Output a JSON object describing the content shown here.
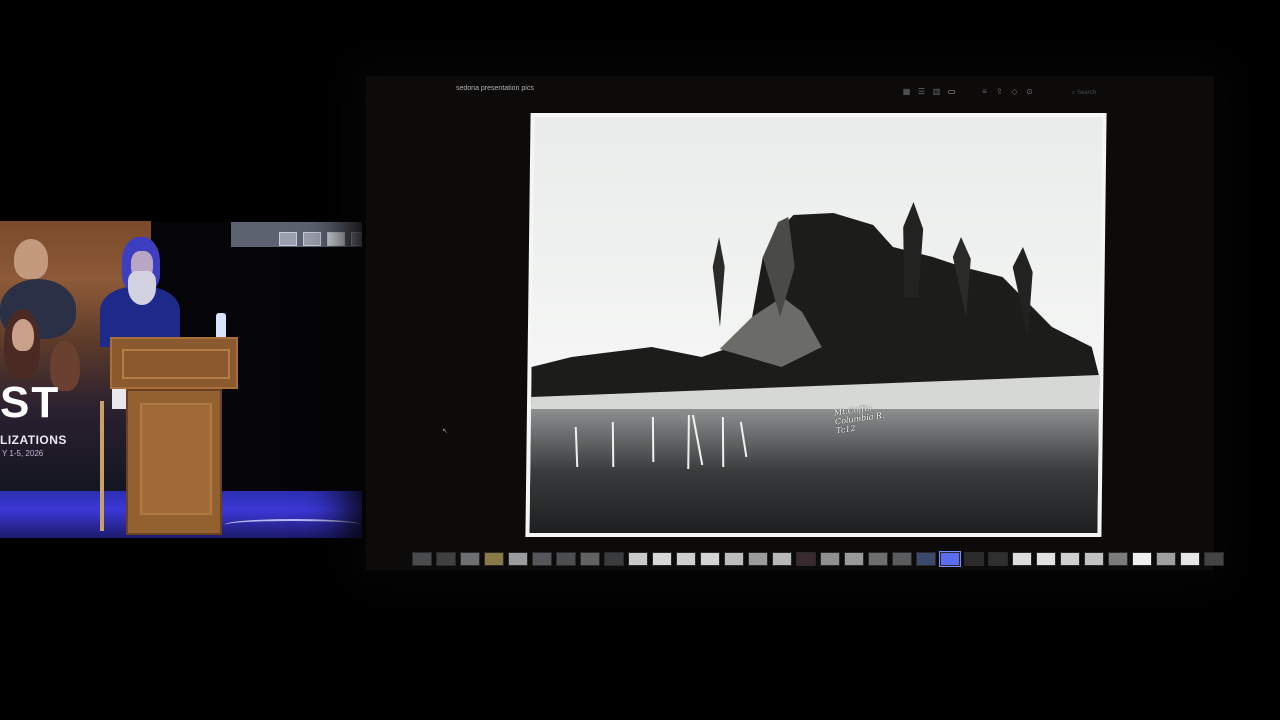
{
  "app": {
    "album_title": "sedona presentation pics",
    "search_placeholder": "Search",
    "toolbar_icons": [
      "grid-small-icon",
      "grid-medium-icon",
      "grid-large-icon",
      "single-view-icon",
      "sort-menu-icon",
      "share-icon",
      "tag-icon",
      "more-menu-icon"
    ],
    "active_view": "single-view-icon"
  },
  "photo": {
    "caption_line1": "Mt.Coffin",
    "caption_line2": "Columbia R.",
    "caption_line3": "Tc12"
  },
  "stage": {
    "banner_letters": "ST",
    "banner_subtitle": "LIZATIONS",
    "banner_date": "Y 1-5, 2026"
  },
  "filmstrip": {
    "count": 34,
    "selected_index": 22,
    "colors": [
      "#4a4b4c",
      "#3f4042",
      "#6e6f70",
      "#8a7a4a",
      "#9a9c9e",
      "#55575a",
      "#4d4e50",
      "#616264",
      "#3a3b3c",
      "#c9c9c9",
      "#d8d8d8",
      "#cfcfcf",
      "#d4d4d4",
      "#bdbdbd",
      "#9c9c9c",
      "#b8b8b8",
      "#3a2a2e",
      "#8f8f8f",
      "#9a9a9a",
      "#6d6e70",
      "#5a5b5c",
      "#3b4a6a",
      "#5b6ef0",
      "#2a2a2a",
      "#2f2f2f",
      "#dcdcdc",
      "#e2e2e2",
      "#d0d0d0",
      "#c2c2c2",
      "#7a7b7c",
      "#f0f0f0",
      "#9fa0a2",
      "#e6e6e6",
      "#444"
    ]
  }
}
